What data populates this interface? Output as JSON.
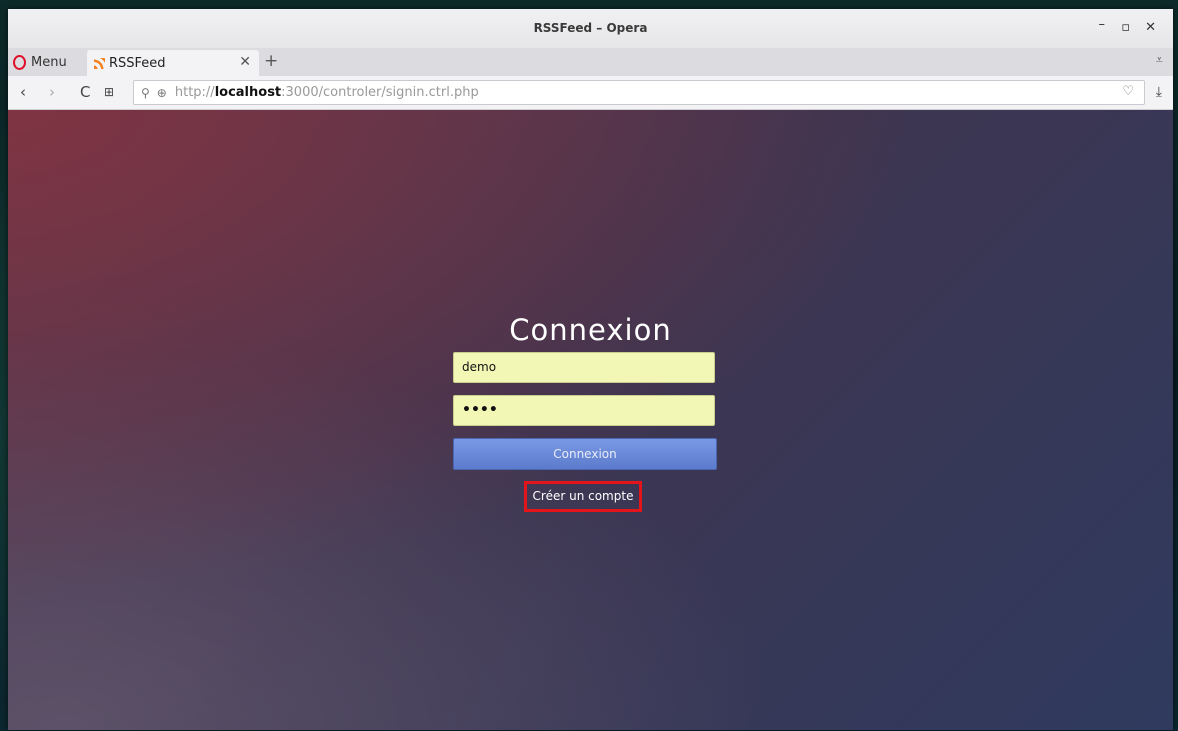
{
  "window": {
    "title": "RSSFeed – Opera",
    "controls": {
      "min": "–",
      "max": "▫",
      "close": "✕"
    }
  },
  "tabbar": {
    "menu_label": "Menu",
    "tab": {
      "label": "RSSFeed",
      "close": "✕",
      "icon": "rss-icon"
    },
    "new_tab": "+",
    "tab_menu": "⩡"
  },
  "addressbar": {
    "back": "‹",
    "forward": "›",
    "reload": "C",
    "speed_dial": "⊞",
    "url_prefix": "http://",
    "url_host": "localhost",
    "url_rest": ":3000/controler/signin.ctrl.php",
    "heart": "♡",
    "download": "⤓"
  },
  "login": {
    "title": "Connexion",
    "username_value": "demo",
    "password_value": "••••",
    "submit_label": "Connexion",
    "signup_label": "Créer un compte"
  },
  "colors": {
    "highlight": "#e3141a",
    "button": "#6b89d8",
    "field": "#f2f7b6"
  }
}
